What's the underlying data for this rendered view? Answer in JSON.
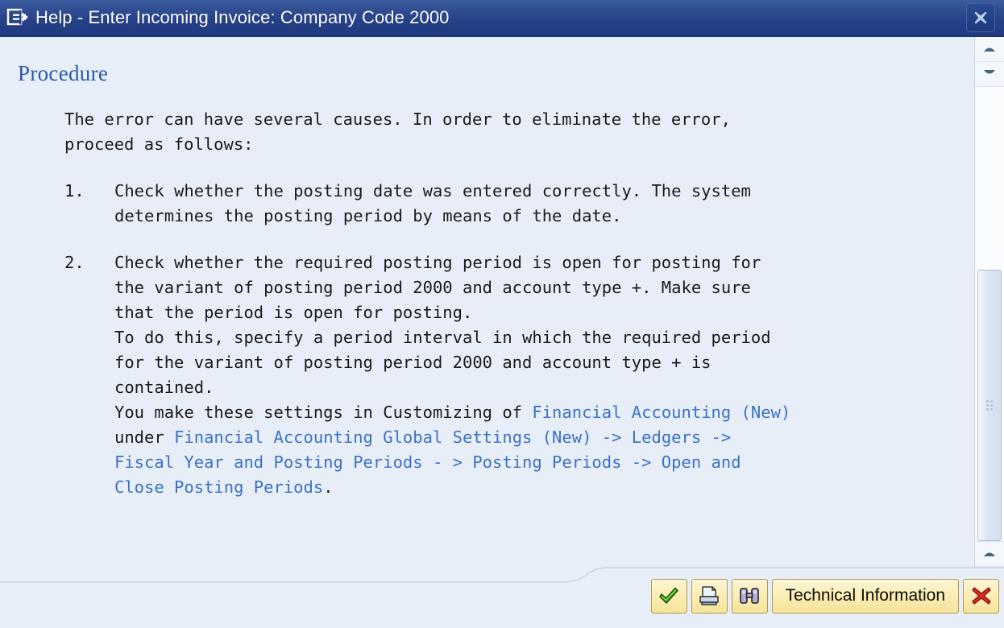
{
  "window": {
    "title": "Help - Enter Incoming Invoice: Company Code 2000",
    "title_icon": "help-exit-icon",
    "close_icon": "close-x-icon"
  },
  "document": {
    "heading": "Procedure",
    "intro": "The error can have several causes. In order to eliminate the error,\nproceed as follows:",
    "items": [
      {
        "number": "1.",
        "segments": [
          {
            "text": "Check whether the posting date was entered correctly. The system\ndetermines the posting period by means of the date.",
            "link": false
          }
        ]
      },
      {
        "number": "2.",
        "segments": [
          {
            "text": "Check whether the required posting period is open for posting for\nthe variant of posting period 2000 and account type +. Make sure\nthat the period is open for posting.\nTo do this, specify a period interval in which the required period\nfor the variant of posting period 2000 and account type + is\ncontained.\nYou make these settings in Customizing of ",
            "link": false
          },
          {
            "text": "Financial Accounting (New)",
            "link": true
          },
          {
            "text": "\nunder ",
            "link": false
          },
          {
            "text": "Financial Accounting Global Settings (New) -> Ledgers ->\nFiscal Year and Posting Periods - > Posting Periods -> Open and\nClose Posting Periods",
            "link": true
          },
          {
            "text": ".",
            "link": false
          }
        ]
      }
    ]
  },
  "scrollbar": {
    "up_top_icon": "triangle-up-icon",
    "down_top_icon": "triangle-down-icon",
    "up_bottom_icon": "triangle-up-icon",
    "down_bottom_icon": "triangle-down-icon",
    "thumb_grip_icon": "grip-dots-icon"
  },
  "toolbar": {
    "buttons": [
      {
        "name": "continue-button",
        "icon": "green-check-icon",
        "label": ""
      },
      {
        "name": "print-button",
        "icon": "printer-icon",
        "label": ""
      },
      {
        "name": "find-button",
        "icon": "binoculars-icon",
        "label": ""
      },
      {
        "name": "technical-information-button",
        "icon": "",
        "label": "Technical Information"
      },
      {
        "name": "cancel-button",
        "icon": "red-x-icon",
        "label": ""
      }
    ]
  },
  "colors": {
    "titlebar": "#27428a",
    "content_bg": "#e8eef7",
    "heading": "#2c5ba8",
    "link": "#3a72c4",
    "button_bg": "#fbeeb6",
    "check_green": "#3fa319",
    "cancel_red": "#d41f1f"
  }
}
